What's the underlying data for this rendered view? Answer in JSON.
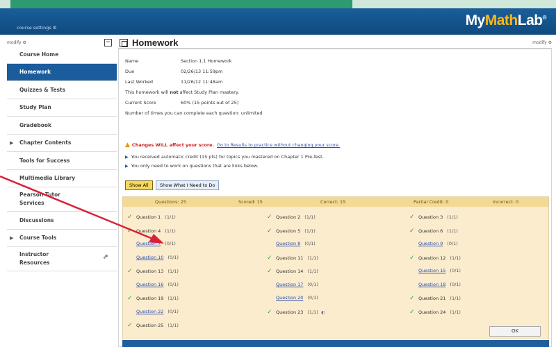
{
  "app": {
    "logo": {
      "my": "My",
      "math": "Math",
      "lab": "Lab",
      "reg": "®"
    },
    "course_link": "course settings ⚙",
    "modify_left": "modify ⚙",
    "modify_right": "modify ⚙"
  },
  "sidebar": {
    "collapse_label": "−",
    "items": [
      {
        "label": "Course Home",
        "active": false,
        "expandable": false
      },
      {
        "label": "Homework",
        "active": true,
        "expandable": false
      },
      {
        "label": "Quizzes & Tests",
        "active": false,
        "expandable": false
      },
      {
        "label": "Study Plan",
        "active": false,
        "expandable": false
      },
      {
        "label": "Gradebook",
        "active": false,
        "expandable": false
      },
      {
        "label": "Chapter Contents",
        "active": false,
        "expandable": true
      },
      {
        "label": "Tools for Success",
        "active": false,
        "expandable": false
      },
      {
        "label": "Multimedia Library",
        "active": false,
        "expandable": false
      },
      {
        "label": "Pearson Tutor Services",
        "active": false,
        "expandable": false
      },
      {
        "label": "Discussions",
        "active": false,
        "expandable": false
      },
      {
        "label": "Course Tools",
        "active": false,
        "expandable": true
      },
      {
        "label": "Instructor Resources",
        "active": false,
        "expandable": false,
        "icon": "external-link-icon"
      }
    ]
  },
  "page": {
    "title": "Homework",
    "info": {
      "name_label": "Name",
      "name_value": "Section 1.1 Homework",
      "due_label": "Due",
      "due_value": "02/26/13 11:59pm",
      "last_label": "Last Worked",
      "last_value": "11/26/12 11:48am",
      "mastery_text_a": "This homework will ",
      "mastery_text_b": "not",
      "mastery_text_c": " affect Study Plan mastery.",
      "score_label": "Current Score",
      "score_value": "60% (15 points out of 25)",
      "attempts_text": "Number of times you can complete each question: unlimited"
    },
    "warning": {
      "icon": "warning-icon",
      "text": "Changes WILL affect your score.",
      "link": "Go to Results to practice without changing your score."
    },
    "bullets": [
      "You received automatic credit (15 pts) for topics you mastered on Chapter 1 Pre-Test.",
      "You only need to work on questions that are links below."
    ],
    "filters": {
      "show_all": "Show All",
      "show_need": "Show What I Need to Do"
    },
    "summary": {
      "questions": "Questions: 25",
      "scored": "Scored: 15",
      "correct": "Correct: 15",
      "partial": "Partial Credit: 0",
      "incorrect": "Incorrect: 0"
    },
    "questions": [
      [
        {
          "name": "Question 1",
          "score": "(1/1)",
          "done": true
        },
        {
          "name": "Question 4",
          "score": "(1/1)",
          "done": true
        },
        {
          "name": "Question 7",
          "score": "(0/1)",
          "done": false
        },
        {
          "name": "Question 10",
          "score": "(0/1)",
          "done": false
        },
        {
          "name": "Question 13",
          "score": "(1/1)",
          "done": true
        },
        {
          "name": "Question 16",
          "score": "(0/1)",
          "done": false
        },
        {
          "name": "Question 19",
          "score": "(1/1)",
          "done": true
        },
        {
          "name": "Question 22",
          "score": "(0/1)",
          "done": false
        },
        {
          "name": "Question 25",
          "score": "(1/1)",
          "done": true
        }
      ],
      [
        {
          "name": "Question 2",
          "score": "(1/1)",
          "done": true
        },
        {
          "name": "Question 5",
          "score": "(1/1)",
          "done": true
        },
        {
          "name": "Question 8",
          "score": "(0/1)",
          "done": false
        },
        {
          "name": "Question 11",
          "score": "(1/1)",
          "done": true
        },
        {
          "name": "Question 14",
          "score": "(1/1)",
          "done": true
        },
        {
          "name": "Question 17",
          "score": "(0/1)",
          "done": false
        },
        {
          "name": "Question 20",
          "score": "(0/1)",
          "done": false
        },
        {
          "name": "Question 23",
          "score": "(1/1)",
          "done": true,
          "help": "help-icon"
        }
      ],
      [
        {
          "name": "Question 3",
          "score": "(1/1)",
          "done": true
        },
        {
          "name": "Question 6",
          "score": "(1/1)",
          "done": true
        },
        {
          "name": "Question 9",
          "score": "(0/1)",
          "done": false
        },
        {
          "name": "Question 12",
          "score": "(1/1)",
          "done": true
        },
        {
          "name": "Question 15",
          "score": "(0/1)",
          "done": false
        },
        {
          "name": "Question 18",
          "score": "(0/1)",
          "done": false
        },
        {
          "name": "Question 21",
          "score": "(1/1)",
          "done": true
        },
        {
          "name": "Question 24",
          "score": "(1/1)",
          "done": true
        }
      ]
    ],
    "ok_label": "OK"
  },
  "colors": {
    "header": "#1b5c9c",
    "active_nav": "#1b5c9c",
    "background": "#cfe8da",
    "accent_bar": "#2e9a72",
    "panel": "#fbeccd",
    "check": "#3e9a2e",
    "link": "#2a4fb0",
    "warning": "#cc2020",
    "annotation_arrow": "#d8203a"
  }
}
